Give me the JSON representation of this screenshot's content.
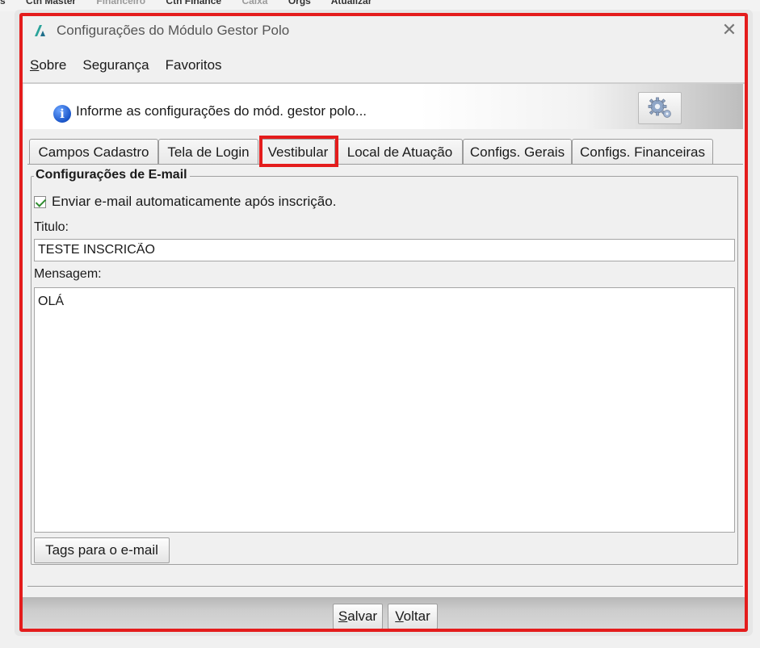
{
  "background_app": {
    "menu_items": [
      "s",
      "Cth Master",
      "Financeiro",
      "Cth Finance",
      "Caixa",
      "Orgs",
      "Atualizar"
    ]
  },
  "window": {
    "title": "Configurações do Módulo Gestor Polo",
    "close_glyph": "✕"
  },
  "menu": {
    "items": [
      {
        "label": "Sobre",
        "mnemonic": "S",
        "rest": "obre"
      },
      {
        "label": "Segurança"
      },
      {
        "label": "Favoritos"
      }
    ]
  },
  "banner": {
    "icon": "info-icon",
    "icon_glyph": "i",
    "text": "Informe as configurações do mód. gestor polo...",
    "button_icon": "gears-icon"
  },
  "tabs": [
    {
      "label": "Campos Cadastro",
      "active": false
    },
    {
      "label": "Tela de Login",
      "active": false
    },
    {
      "label": "Vestibular",
      "active": true
    },
    {
      "label": "Local de Atuação",
      "active": false
    },
    {
      "label": "Configs. Gerais",
      "active": false
    },
    {
      "label": "Configs. Financeiras",
      "active": false
    }
  ],
  "email_group": {
    "title": "Configurações de E-mail",
    "auto_send": {
      "label": "Enviar e-mail automaticamente após inscrição.",
      "checked": true
    },
    "title_label": "Titulo:",
    "title_value": "TESTE INSCRICÃO",
    "message_label": "Mensagem:",
    "message_value": "OLÁ",
    "tags_button": "Tags para o e-mail"
  },
  "footer": {
    "save": {
      "label": "Salvar",
      "mnemonic": "S",
      "rest": "alvar"
    },
    "back": {
      "label": "Voltar",
      "mnemonic": "V",
      "rest": "oltar"
    }
  },
  "colors": {
    "highlight": "#e41c1c",
    "info_icon": "#1a56c9",
    "check": "#2e8b2e"
  }
}
